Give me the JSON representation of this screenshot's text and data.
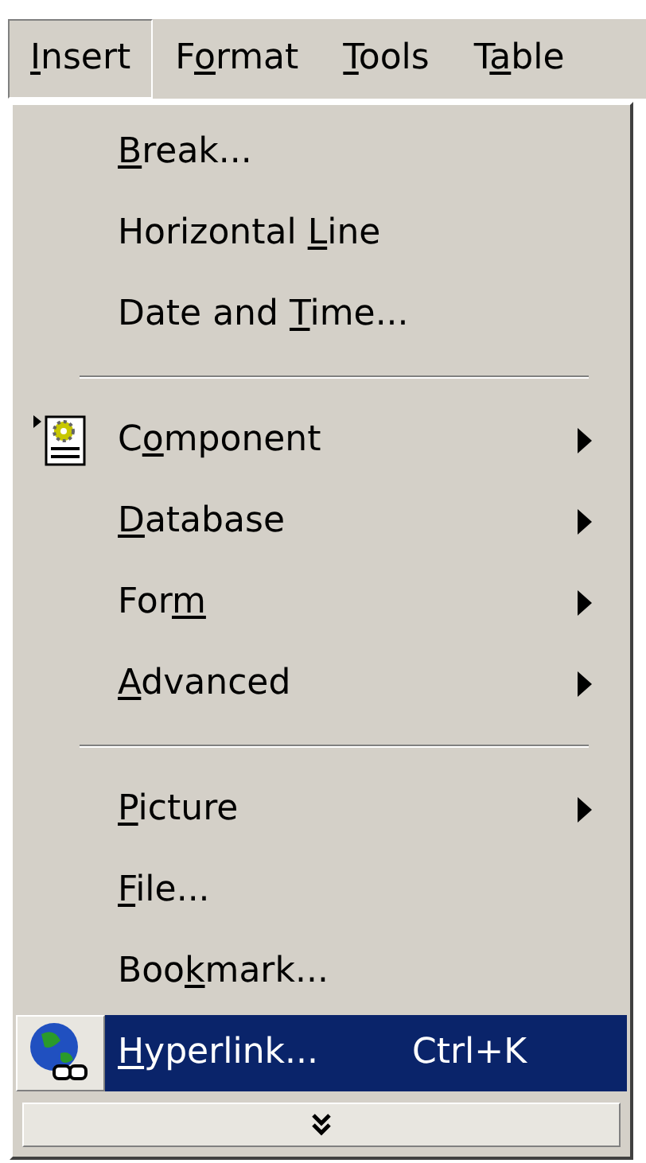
{
  "menu_bar": [
    {
      "label": {
        "key": "I",
        "after": "nsert"
      },
      "selected": true
    },
    {
      "label": {
        "before": "F",
        "key": "o",
        "after": "rmat"
      },
      "selected": false
    },
    {
      "label": {
        "key": "T",
        "after": "ools"
      },
      "selected": false
    },
    {
      "label": {
        "before": "T",
        "key": "a",
        "after": "ble"
      },
      "selected": false
    }
  ],
  "menu": {
    "items": [
      {
        "kind": "command",
        "label": {
          "key": "B",
          "after": "reak..."
        },
        "selected": false
      },
      {
        "kind": "command",
        "label": {
          "before": "Horizontal ",
          "key": "L",
          "after": "ine"
        },
        "selected": false
      },
      {
        "kind": "command",
        "label": {
          "before": "Date and ",
          "key": "T",
          "after": "ime..."
        },
        "selected": false
      },
      {
        "kind": "separator"
      },
      {
        "kind": "component_submenu",
        "label": {
          "before": "C",
          "key": "o",
          "after": "mponent"
        },
        "selected": false
      },
      {
        "kind": "submenu",
        "label": {
          "key": "D",
          "after": "atabase"
        },
        "selected": false
      },
      {
        "kind": "submenu",
        "label": {
          "before": "For",
          "key": "m"
        },
        "selected": false
      },
      {
        "kind": "submenu",
        "label": {
          "key": "A",
          "after": "dvanced"
        },
        "selected": false
      },
      {
        "kind": "separator"
      },
      {
        "kind": "submenu",
        "label": {
          "key": "P",
          "after": "icture"
        },
        "selected": false
      },
      {
        "kind": "command",
        "label": {
          "key": "F",
          "after": "ile..."
        },
        "selected": false
      },
      {
        "kind": "command",
        "label": {
          "before": "Boo",
          "key": "k",
          "after": "mark..."
        },
        "selected": false
      },
      {
        "kind": "link_command",
        "label": {
          "key": "H",
          "after": "yperlink..."
        },
        "shortcut": "Ctrl+K",
        "selected": true
      }
    ]
  }
}
